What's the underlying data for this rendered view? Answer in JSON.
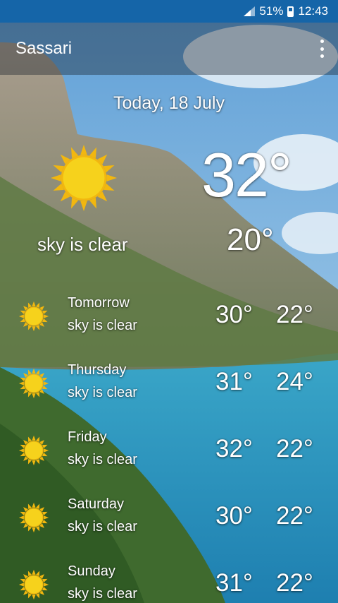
{
  "status_bar": {
    "battery": "51%",
    "time": "12:43"
  },
  "app_bar": {
    "title": "Sassari",
    "menu_icon": "more-vertical-icon"
  },
  "today": {
    "date": "Today, 18 July",
    "condition": "sky is clear",
    "high": "32°",
    "low": "20°",
    "icon": "sun-icon"
  },
  "forecast": [
    {
      "day": "Tomorrow",
      "condition": "sky is clear",
      "high": "30°",
      "low": "22°",
      "icon": "sun-icon"
    },
    {
      "day": "Thursday",
      "condition": "sky is clear",
      "high": "31°",
      "low": "24°",
      "icon": "sun-icon"
    },
    {
      "day": "Friday",
      "condition": "sky is clear",
      "high": "32°",
      "low": "22°",
      "icon": "sun-icon"
    },
    {
      "day": "Saturday",
      "condition": "sky is clear",
      "high": "30°",
      "low": "22°",
      "icon": "sun-icon"
    },
    {
      "day": "Sunday",
      "condition": "sky is clear",
      "high": "31°",
      "low": "22°",
      "icon": "sun-icon"
    }
  ],
  "colors": {
    "status_bar": "#1565a8",
    "sun_fill": "#f6d21c",
    "sun_rays": "#f2b70f"
  }
}
